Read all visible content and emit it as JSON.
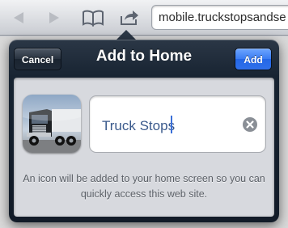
{
  "browser": {
    "url": "mobile.truckstopsandse",
    "icons": [
      "back-arrow-icon",
      "forward-arrow-icon",
      "bookmarks-icon",
      "share-icon"
    ]
  },
  "dialog": {
    "title": "Add to Home",
    "cancel_label": "Cancel",
    "add_label": "Add",
    "name_value": "Truck Stops",
    "hint": "An icon will be added to your home screen so you can quickly access this web site.",
    "app_icon": "truck-icon"
  },
  "colors": {
    "popover": "#172331",
    "add_button": "#2f70ea",
    "input_text": "#3b5a8c"
  }
}
